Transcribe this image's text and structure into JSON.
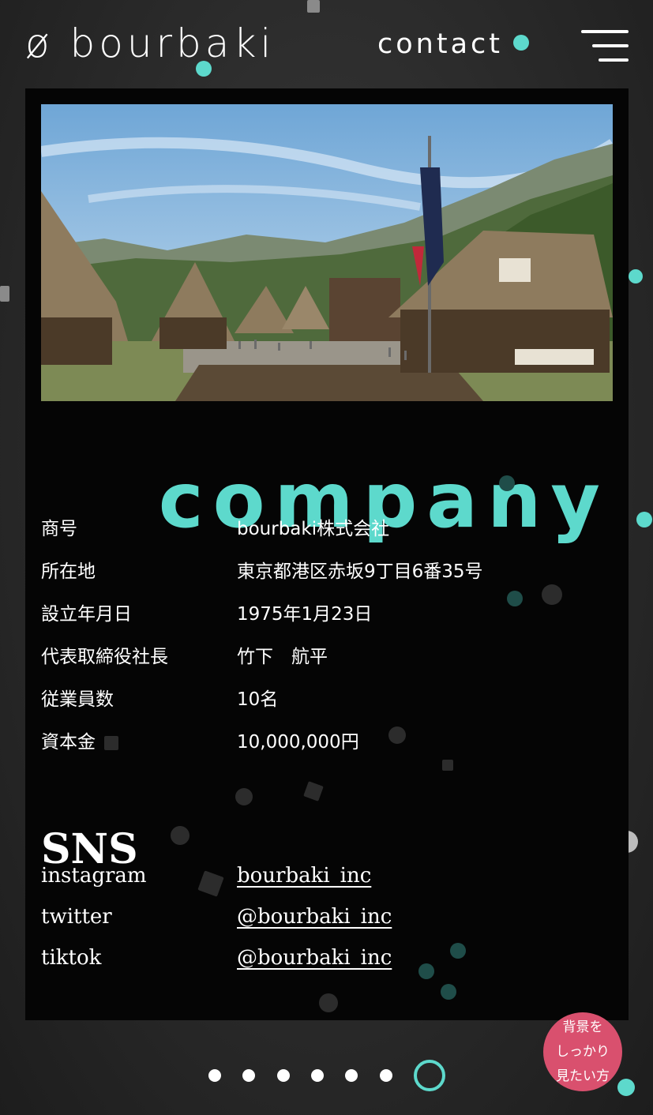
{
  "header": {
    "logo": "ø bourbaki",
    "contact_label": "contact"
  },
  "hero": {
    "image_alt": "Shirakawa-go thatched-roof village with koinobori pole under blue sky"
  },
  "section": {
    "title": "company"
  },
  "company_info": [
    {
      "label": "商号",
      "value": "bourbaki株式会社"
    },
    {
      "label": "所在地",
      "value": "東京都港区赤坂9丁目6番35号"
    },
    {
      "label": "設立年月日",
      "value": "1975年1月23日"
    },
    {
      "label": "代表取締役社長",
      "value": "竹下　航平"
    },
    {
      "label": "従業員数",
      "value": "10名"
    },
    {
      "label": "資本金",
      "value": "10,000,000円"
    }
  ],
  "sns": {
    "title": "SNS",
    "items": [
      {
        "label": "instagram",
        "handle": "bourbaki_inc"
      },
      {
        "label": "twitter",
        "handle": "@bourbaki_inc"
      },
      {
        "label": "tiktok",
        "handle": "@bourbaki_inc"
      }
    ]
  },
  "pager": {
    "count": 7,
    "active_index": 6
  },
  "bg_toggle": {
    "line1": "背景を",
    "line2": "しっかり",
    "line3": "見たい方"
  },
  "colors": {
    "accent": "#5dd9cc",
    "toggle": "#d9506e",
    "panel": "#050505"
  }
}
